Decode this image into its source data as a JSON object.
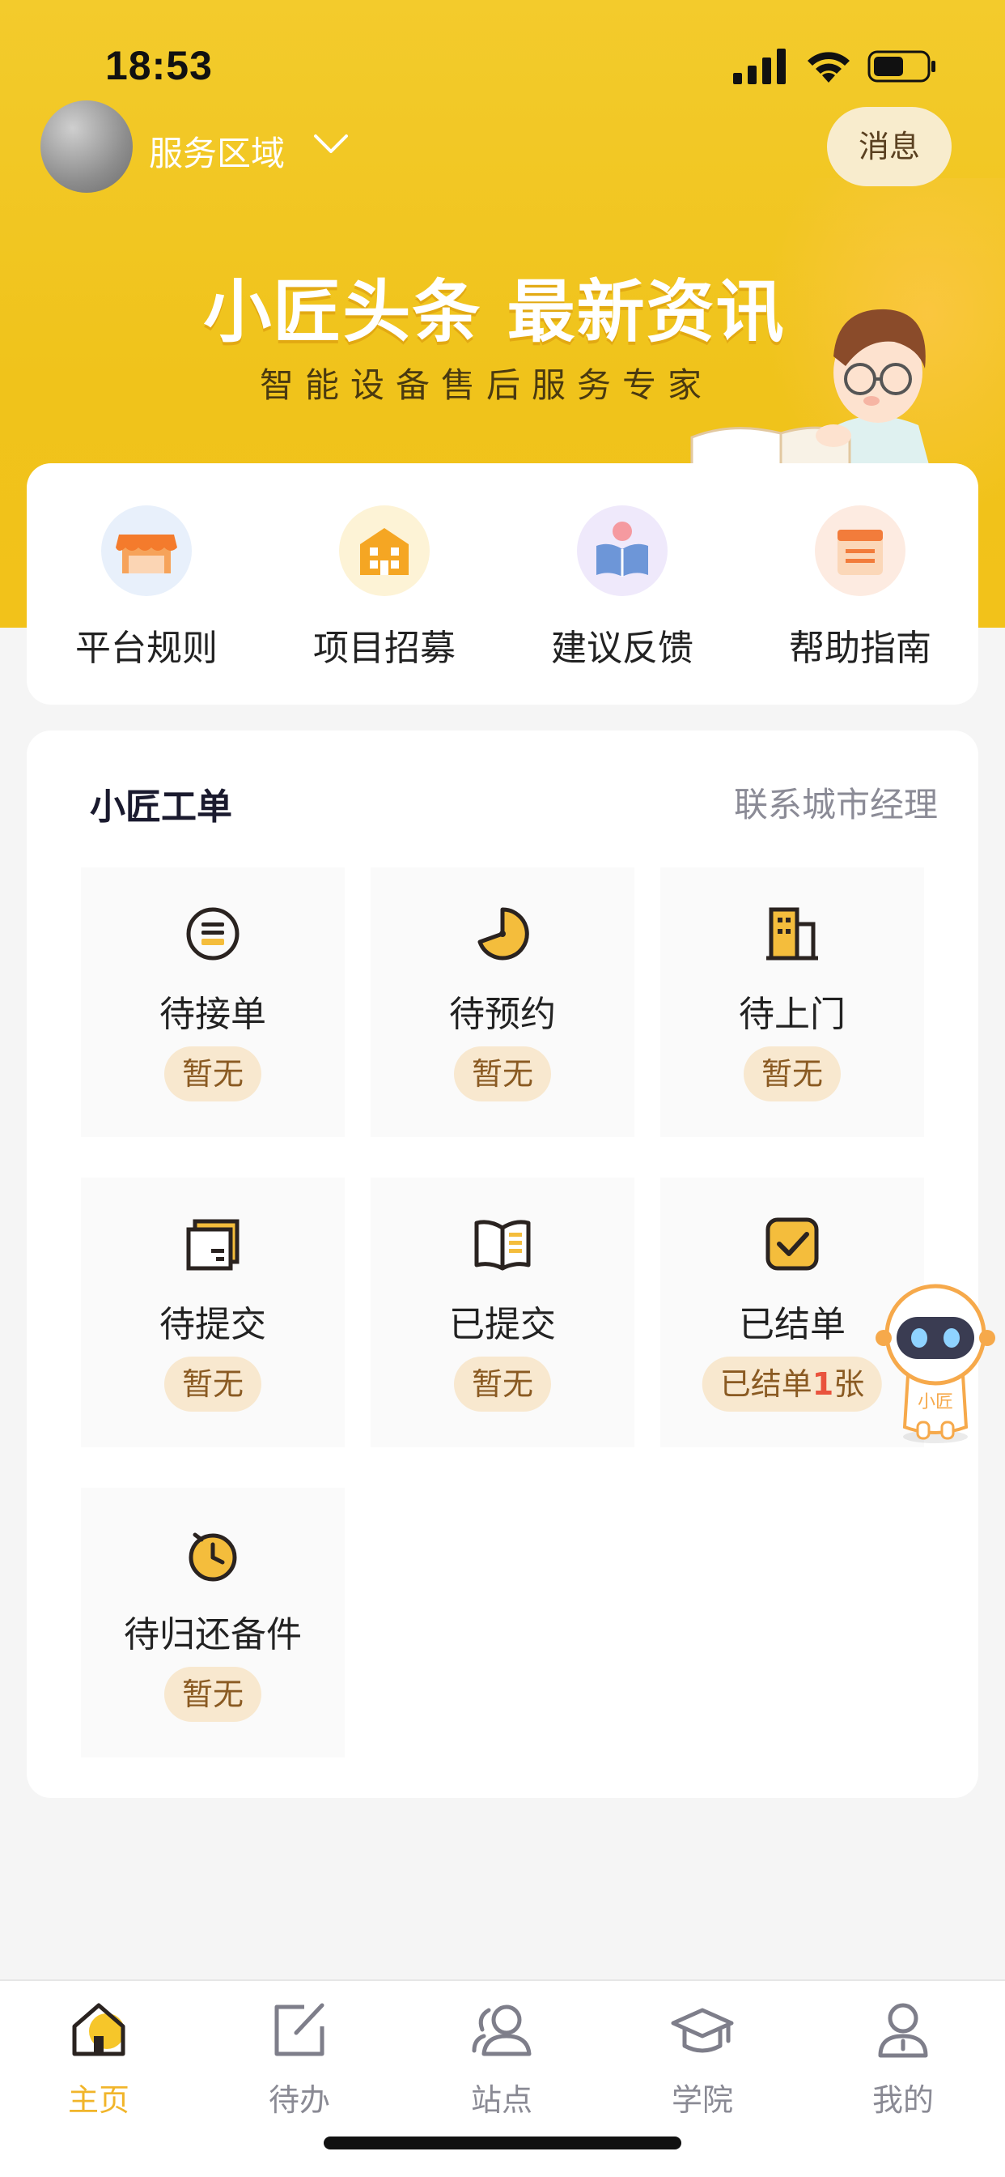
{
  "status_bar": {
    "time": "18:53"
  },
  "header": {
    "area_label": "服务区域",
    "message_button": "消息"
  },
  "banner": {
    "title": "小匠头条 最新资讯",
    "subtitle": "智能设备售后服务专家"
  },
  "shortcuts": [
    {
      "label": "平台规则",
      "icon": "storefront-icon"
    },
    {
      "label": "项目招募",
      "icon": "building-icon"
    },
    {
      "label": "建议反馈",
      "icon": "feedback-book-icon"
    },
    {
      "label": "帮助指南",
      "icon": "calendar-guide-icon"
    }
  ],
  "work_orders": {
    "title": "小匠工单",
    "contact_link": "联系城市经理",
    "tiles": [
      {
        "label": "待接单",
        "badge": "暂无",
        "icon": "order-list-icon"
      },
      {
        "label": "待预约",
        "badge": "暂无",
        "icon": "clock-moon-icon"
      },
      {
        "label": "待上门",
        "badge": "暂无",
        "icon": "building-door-icon"
      },
      {
        "label": "待提交",
        "badge": "暂无",
        "icon": "submit-window-icon"
      },
      {
        "label": "已提交",
        "badge": "暂无",
        "icon": "open-book-icon"
      },
      {
        "label": "已结单",
        "badge_prefix": "已结单",
        "badge_count": "1",
        "badge_suffix": "张",
        "icon": "checkbox-icon"
      },
      {
        "label": "待归还备件",
        "badge": "暂无",
        "icon": "stopwatch-icon"
      }
    ]
  },
  "robot": {
    "label": "小匠"
  },
  "nav": [
    {
      "label": "主页",
      "icon": "home-icon",
      "active": true
    },
    {
      "label": "待办",
      "icon": "edit-icon",
      "active": false
    },
    {
      "label": "站点",
      "icon": "users-icon",
      "active": false
    },
    {
      "label": "学院",
      "icon": "graduation-cap-icon",
      "active": false
    },
    {
      "label": "我的",
      "icon": "person-icon",
      "active": false
    }
  ],
  "colors": {
    "brand_yellow": "#f2c41e",
    "accent_orange": "#f1b52a",
    "badge_bg": "#f8e8cf",
    "badge_text": "#8a5a22",
    "count_red": "#e9533d"
  }
}
